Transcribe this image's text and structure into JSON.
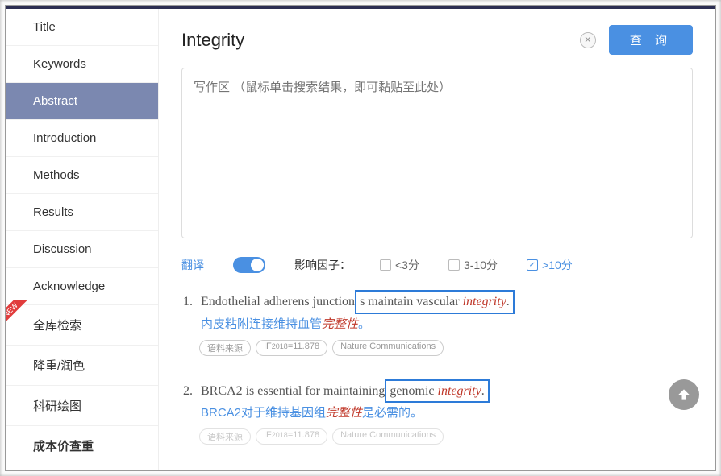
{
  "sidebar": {
    "items": [
      {
        "label": "Title"
      },
      {
        "label": "Keywords"
      },
      {
        "label": "Abstract"
      },
      {
        "label": "Introduction"
      },
      {
        "label": "Methods"
      },
      {
        "label": "Results"
      },
      {
        "label": "Discussion"
      },
      {
        "label": "Acknowledge"
      },
      {
        "label": "全库检索"
      },
      {
        "label": "降重/润色"
      },
      {
        "label": "科研绘图"
      },
      {
        "label": "成本价查重"
      }
    ],
    "active_index": 2,
    "new_badge_index": 8,
    "new_badge_text": "NEW"
  },
  "search": {
    "value": "Integrity",
    "button": "查 询"
  },
  "writearea": {
    "placeholder": "写作区 （鼠标单击搜索结果，即可黏贴至此处）"
  },
  "filters": {
    "translate_label": "翻译",
    "if_label": "影响因子：",
    "options": [
      {
        "text": "<3分",
        "checked": false
      },
      {
        "text": "3-10分",
        "checked": false
      },
      {
        "text": ">10分",
        "checked": true
      }
    ]
  },
  "results": [
    {
      "num": "1.",
      "pre": "Endothelial adherens junction",
      "boxed_pre": "s maintain vascular ",
      "boxed_hl": "integrity",
      "boxed_post": ".",
      "trans_pre": "内皮粘附连接维持血管",
      "trans_hl": "完整性",
      "trans_post": "。",
      "tags": [
        "语料来源",
        "IF2018=11.878",
        "Nature Communications"
      ]
    },
    {
      "num": "2.",
      "pre": "BRCA2 is essential for maintaining",
      "boxed_pre": " genomic ",
      "boxed_hl": "integrity",
      "boxed_post": ".",
      "trans_pre": "BRCA2对于维持基因组",
      "trans_hl": "完整性",
      "trans_post": "是必需的。",
      "tags": [
        "语料来源",
        "IF2018=11.878",
        "Nature Communications"
      ]
    }
  ]
}
